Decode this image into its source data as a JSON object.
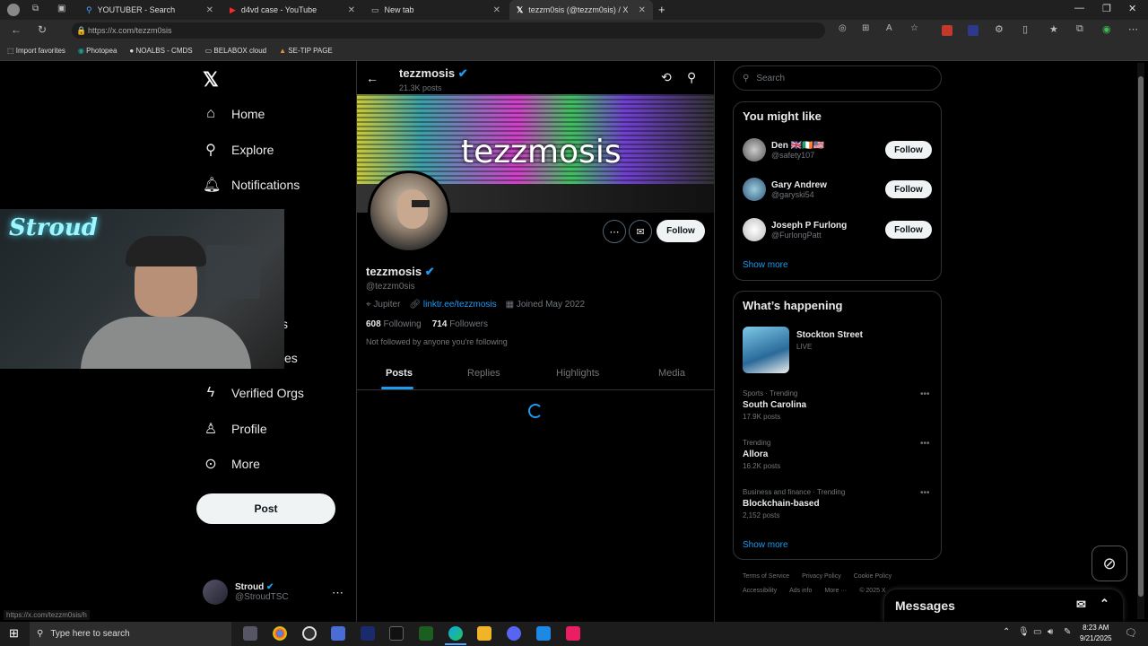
{
  "browser": {
    "tabs": [
      {
        "label": "YOUTUBER - Search"
      },
      {
        "label": "d4vd case - YouTube"
      },
      {
        "label": "New tab"
      },
      {
        "label": "tezzm0sis (@tezzm0sis) / X"
      }
    ],
    "url": "https://x.com/tezzm0sis",
    "bookmarks": [
      "Import favorites",
      "Photopea",
      "NOALBS - CMDS",
      "BELABOX cloud",
      "SE-TIP PAGE"
    ],
    "status_url": "https://x.com/tezzm0sis/h"
  },
  "nav": {
    "home": "Home",
    "explore": "Explore",
    "notifications": "Notifications",
    "partial_1": "s",
    "partial_2": "ties",
    "verified_orgs": "Verified Orgs",
    "profile": "Profile",
    "more": "More",
    "post": "Post"
  },
  "account": {
    "name": "Stroud",
    "handle": "@StroudTSC"
  },
  "profile": {
    "header_name": "tezzmosis",
    "posts_count": "21.3K posts",
    "banner_text": "tezzmosis",
    "name": "tezzmosis",
    "handle": "@tezzm0sis",
    "location": "Jupiter",
    "link": "linktr.ee/tezzmosis",
    "joined": "Joined May 2022",
    "following_count": "608",
    "following_label": "Following",
    "followers_count": "714",
    "followers_label": "Followers",
    "followed_by": "Not followed by anyone you're following",
    "follow_label": "Follow",
    "tabs": [
      "Posts",
      "Replies",
      "Highlights",
      "Media"
    ]
  },
  "right": {
    "search_placeholder": "Search",
    "might_like_title": "You might like",
    "suggestions": [
      {
        "name": "Den 🇬🇧🇮🇪🇺🇸",
        "handle": "@safety107",
        "button": "Follow"
      },
      {
        "name": "Gary Andrew",
        "handle": "@garyski54",
        "button": "Follow"
      },
      {
        "name": "Joseph P Furlong",
        "handle": "@FurlongPatt",
        "button": "Follow"
      }
    ],
    "show_more": "Show more",
    "happening_title": "What’s happening",
    "live": {
      "title": "Stockton Street",
      "status": "LIVE"
    },
    "trends": [
      {
        "context": "Sports · Trending",
        "topic": "South Carolina",
        "count": "17.9K posts"
      },
      {
        "context": "Trending",
        "topic": "Allora",
        "count": "16.2K posts"
      },
      {
        "context": "Business and finance · Trending",
        "topic": "Blockchain-based",
        "count": "2,152 posts"
      }
    ],
    "show_more_2": "Show more",
    "footer_1": [
      "Terms of Service",
      "Privacy Policy",
      "Cookie Policy"
    ],
    "footer_2": [
      "Accessibility",
      "Ads info",
      "More ···",
      "© 2025 X"
    ]
  },
  "messages": {
    "title": "Messages"
  },
  "taskbar": {
    "search_placeholder": "Type here to search",
    "time": "8:23 AM",
    "date": "9/21/2025"
  },
  "colors": {
    "accent": "#1d9bf0",
    "background": "#000000",
    "verified": "#1d9bf0"
  }
}
